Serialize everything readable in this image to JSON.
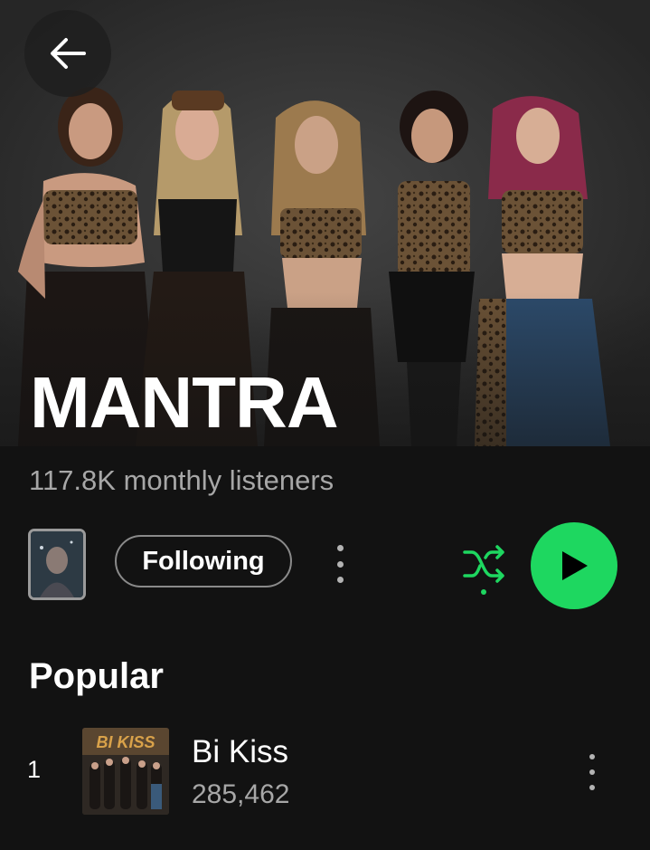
{
  "artist": {
    "name": "MANTRA",
    "monthly_listeners": "117.8K monthly listeners"
  },
  "header": {
    "back_icon": "arrow-left-icon"
  },
  "actions": {
    "follow_label": "Following",
    "more_icon": "more-vertical-icon",
    "shuffle_icon": "shuffle-icon",
    "play_icon": "play-icon"
  },
  "popular": {
    "title": "Popular",
    "tracks": [
      {
        "rank": "1",
        "title": "Bi Kiss",
        "plays": "285,462",
        "cover_text": "BI KISS"
      }
    ]
  },
  "colors": {
    "accent": "#1ed760",
    "background": "#121212",
    "secondary_text": "#a7a7a7"
  }
}
